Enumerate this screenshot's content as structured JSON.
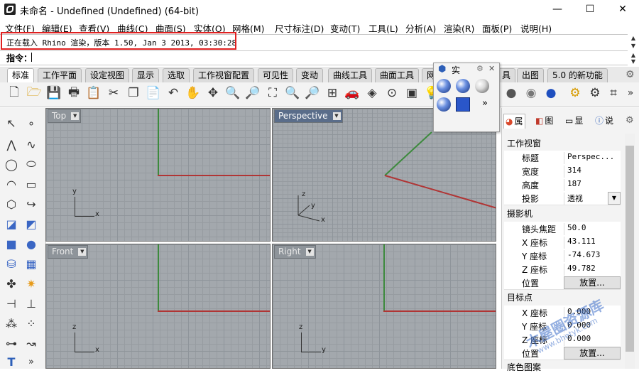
{
  "window": {
    "title": "未命名 - Undefined (Undefined) (64-bit)",
    "minimize": "—",
    "maximize": "☐",
    "close": "✕"
  },
  "menu": [
    "文件(F)",
    "编辑(E)",
    "查看(V)",
    "曲线(C)",
    "曲面(S)",
    "实体(O)",
    "网格(M)",
    "尺寸标注(D)",
    "变动(T)",
    "工具(L)",
    "分析(A)",
    "渲染(R)",
    "面板(P)",
    "说明(H)"
  ],
  "command": {
    "history": "正在载入 Rhino 渲染，版本 1.50, Jan  3 2013, 03:30:28",
    "prompt": "指令："
  },
  "tabs": [
    "标准",
    "工作平面",
    "设定视图",
    "显示",
    "选取",
    "工作视窗配置",
    "可见性",
    "变动",
    "曲线工具",
    "曲面工具",
    "网",
    "具",
    "出图",
    "5.0 的新功能"
  ],
  "floating_panel": {
    "title": "实"
  },
  "viewports": {
    "top": "Top",
    "perspective": "Perspective",
    "front": "Front",
    "right": "Right"
  },
  "axis_letters": {
    "x": "x",
    "y": "y",
    "z": "z"
  },
  "panel_tabs": [
    "属",
    "图",
    "显",
    "说"
  ],
  "properties": {
    "viewport_section": "工作视窗",
    "title_label": "标题",
    "title_value": "Perspec...",
    "width_label": "宽度",
    "width_value": "314",
    "height_label": "高度",
    "height_value": "187",
    "projection_label": "投影",
    "projection_value": "透视",
    "camera_section": "摄影机",
    "focal_label": "镜头焦距",
    "focal_value": "50.0",
    "cx_label": "X 座标",
    "cx_value": "43.111",
    "cy_label": "Y 座标",
    "cy_value": "-74.673",
    "cz_label": "Z 座标",
    "cz_value": "49.782",
    "pos_label": "位置",
    "pos_button": "放置...",
    "target_section": "目标点",
    "tx_label": "X 座标",
    "tx_value": "0.000",
    "ty_label": "Y 座标",
    "ty_value": "0.000",
    "tz_label": "Z 座标",
    "tz_value": "0.000",
    "tpos_label": "位置",
    "tpos_button": "放置...",
    "bg_section": "底色图案"
  },
  "watermark": {
    "text": "木屋圈资源库",
    "url": "www.bhetyk.com"
  },
  "colors": {
    "highlight": "#e02020",
    "x_axis": "#b03535",
    "y_axis": "#3d8a3d",
    "active_viewport": "#5a6d8a"
  }
}
